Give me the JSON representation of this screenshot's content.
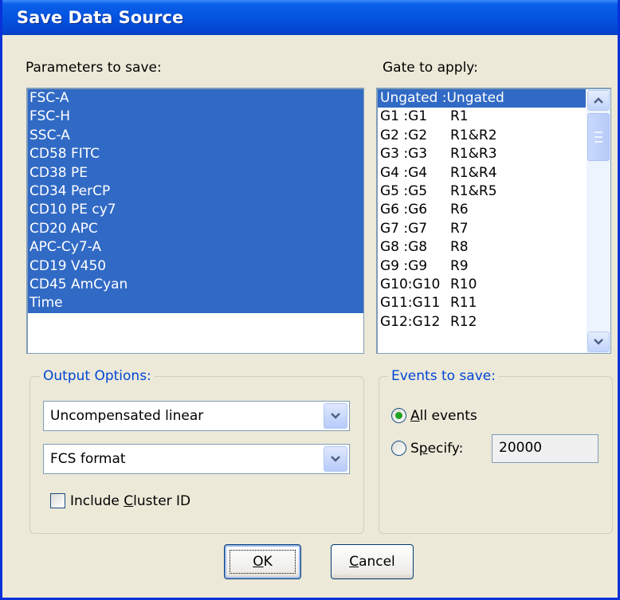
{
  "window": {
    "title": "Save Data Source"
  },
  "params": {
    "label": "Parameters to save:",
    "items": [
      "FSC-A",
      "FSC-H",
      "SSC-A",
      "CD58 FITC",
      "CD38 PE",
      "CD34 PerCP",
      "CD10 PE cy7",
      "CD20 APC",
      "APC-Cy7-A",
      "CD19 V450",
      "CD45 AmCyan",
      "Time"
    ]
  },
  "gates": {
    "label": "Gate to apply:",
    "items": [
      {
        "name": "Ungated :Ungated",
        "region": ""
      },
      {
        "name": "G1 :G1",
        "region": "R1"
      },
      {
        "name": "G2 :G2",
        "region": "R1&R2"
      },
      {
        "name": "G3 :G3",
        "region": "R1&R3"
      },
      {
        "name": "G4 :G4",
        "region": "R1&R4"
      },
      {
        "name": "G5 :G5",
        "region": "R1&R5"
      },
      {
        "name": "G6 :G6",
        "region": "R6"
      },
      {
        "name": "G7 :G7",
        "region": "R7"
      },
      {
        "name": "G8 :G8",
        "region": "R8"
      },
      {
        "name": "G9 :G9",
        "region": "R9"
      },
      {
        "name": "G10:G10",
        "region": "R10"
      },
      {
        "name": "G11:G11",
        "region": "R11"
      },
      {
        "name": "G12:G12",
        "region": "R12"
      }
    ],
    "selected_index": 0
  },
  "output": {
    "legend": "Output Options:",
    "compensation": "Uncompensated linear",
    "format": "FCS format",
    "cluster_pre": "Include ",
    "cluster_u": "C",
    "cluster_post": "luster ID",
    "cluster_checked": false
  },
  "events": {
    "legend": "Events to save:",
    "all_u": "A",
    "all_rest": "ll events",
    "all_selected": true,
    "spec_pre": "S",
    "spec_u": "p",
    "spec_post": "ecify:",
    "count": "20000"
  },
  "buttons": {
    "ok_u": "O",
    "ok_rest": "K",
    "cancel_u": "C",
    "cancel_rest": "ancel"
  },
  "colors": {
    "title_bar": "#0553e0",
    "selection": "#316ac5",
    "group_label": "#0046d5",
    "radio_dot": "#21a121"
  }
}
